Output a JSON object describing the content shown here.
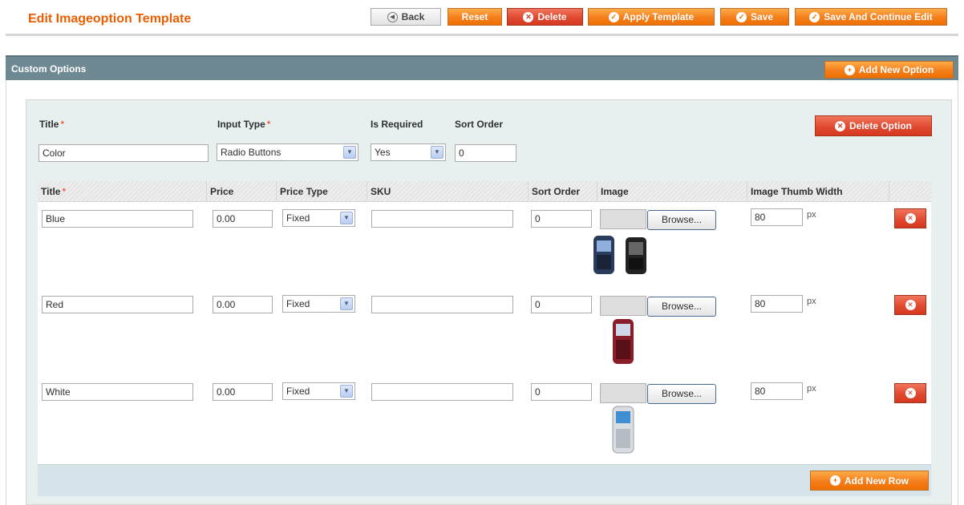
{
  "page": {
    "title": "Edit Imageoption Template"
  },
  "toolbar": {
    "back": "Back",
    "reset": "Reset",
    "delete": "Delete",
    "apply_template": "Apply Template",
    "save": "Save",
    "save_continue": "Save And Continue Edit"
  },
  "section": {
    "title": "Custom Options",
    "add_option": "Add New Option"
  },
  "option": {
    "labels": {
      "title": "Title",
      "input_type": "Input Type",
      "is_required": "Is Required",
      "sort_order": "Sort Order",
      "required_mark": "*"
    },
    "title_value": "Color",
    "input_type_value": "Radio Buttons",
    "is_required_value": "Yes",
    "sort_order_value": "0",
    "delete_option": "Delete Option"
  },
  "grid": {
    "columns": {
      "title": "Title",
      "price": "Price",
      "price_type": "Price Type",
      "sku": "SKU",
      "sort_order": "Sort Order",
      "image": "Image",
      "thumb_width": "Image Thumb Width"
    },
    "browse_label": "Browse...",
    "px_label": "px",
    "rows": [
      {
        "title": "Blue",
        "price": "0.00",
        "price_type": "Fixed",
        "sku": "",
        "sort_order": "0",
        "thumb_width": "80",
        "thumb_icon": "phone-pair-icon"
      },
      {
        "title": "Red",
        "price": "0.00",
        "price_type": "Fixed",
        "sku": "",
        "sort_order": "0",
        "thumb_width": "80",
        "thumb_icon": "red-phone-icon"
      },
      {
        "title": "White",
        "price": "0.00",
        "price_type": "Fixed",
        "sku": "",
        "sort_order": "0",
        "thumb_width": "80",
        "thumb_icon": "white-phone-icon"
      }
    ],
    "add_row": "Add New Row"
  },
  "colors": {
    "accent_orange": "#ee6f00",
    "delete_red": "#d5381f",
    "section_header": "#6f8992",
    "option_bg": "#e7efef",
    "title_orange": "#eb5e00"
  }
}
